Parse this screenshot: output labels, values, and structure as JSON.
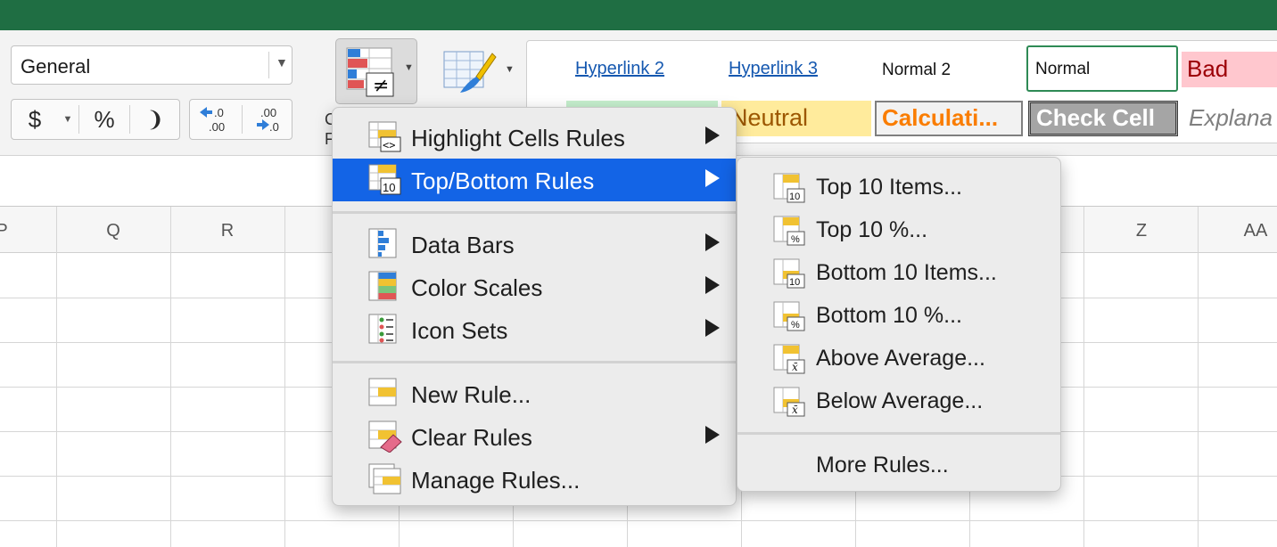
{
  "ribbon": {
    "number_format": "General",
    "currency_symbol": "$",
    "percent_symbol": "%",
    "comma_symbol": "❩",
    "increase_decimal": ".0",
    "increase_decimal_2": ".00",
    "decrease_decimal": ".00",
    "decrease_decimal_2": ".0",
    "cf_label_char": "≠",
    "styles": {
      "hyperlink2": "Hyperlink 2",
      "hyperlink3": "Hyperlink 3",
      "normal2": "Normal 2",
      "normal": "Normal",
      "bad": "Bad",
      "neutral": "Neutral",
      "calculation": "Calculati...",
      "check_cell": "Check Cell",
      "explanatory": "Explana"
    }
  },
  "sheet": {
    "columns": [
      "P",
      "Q",
      "R",
      "Z",
      "AA"
    ]
  },
  "menu": {
    "items": [
      {
        "label": "Highlight Cells Rules"
      },
      {
        "label": "Top/Bottom Rules"
      },
      {
        "label": "Data Bars"
      },
      {
        "label": "Color Scales"
      },
      {
        "label": "Icon Sets"
      },
      {
        "label": "New Rule..."
      },
      {
        "label": "Clear Rules"
      },
      {
        "label": "Manage Rules..."
      }
    ]
  },
  "submenu": {
    "items": [
      {
        "label": "Top 10 Items...",
        "badge": "10"
      },
      {
        "label": "Top 10 %...",
        "badge": "%"
      },
      {
        "label": "Bottom 10 Items...",
        "badge": "10"
      },
      {
        "label": "Bottom 10 %...",
        "badge": "%"
      },
      {
        "label": "Above Average...",
        "badge": "x̄"
      },
      {
        "label": "Below Average...",
        "badge": "x̄"
      },
      {
        "label": "More Rules..."
      }
    ]
  },
  "colors": {
    "title_bar": "#1f6e43",
    "menu_highlight": "#1364e6",
    "good_fill": "#c6efce",
    "bad_fill": "#ffc7ce",
    "bad_text": "#9c0006",
    "neutral_fill": "#ffeb9c",
    "neutral_text": "#9c5700",
    "calculation_text": "#fa7d00"
  }
}
